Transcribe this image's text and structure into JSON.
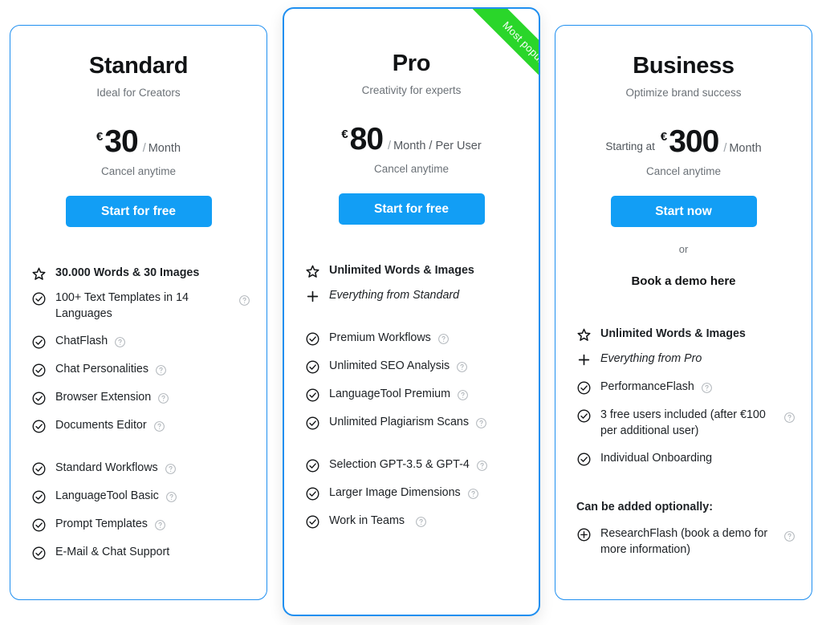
{
  "plans": [
    {
      "id": "standard",
      "name": "Standard",
      "tagline": "Ideal for Creators",
      "price": {
        "starting_at": "",
        "currency": "€",
        "amount": "30",
        "slash": "/",
        "period": "Month"
      },
      "cancel_note": "Cancel anytime",
      "cta_label": "Start for free",
      "or_label": "",
      "demo_link": "",
      "feature_groups": [
        {
          "items": [
            {
              "icon": "star-icon",
              "label": "30.000 Words & 30 Images",
              "style": "bold",
              "help": false,
              "wrap": false
            },
            {
              "icon": "check-circle-icon",
              "label": "100+ Text Templates in 14 Languages",
              "style": "normal",
              "help": true,
              "wrap": true
            },
            {
              "icon": "check-circle-icon",
              "label": "ChatFlash",
              "style": "normal",
              "help": true,
              "wrap": false
            },
            {
              "icon": "check-circle-icon",
              "label": "Chat Personalities",
              "style": "normal",
              "help": true,
              "wrap": false
            },
            {
              "icon": "check-circle-icon",
              "label": "Browser Extension",
              "style": "normal",
              "help": true,
              "wrap": false
            },
            {
              "icon": "check-circle-icon",
              "label": "Documents Editor",
              "style": "normal",
              "help": true,
              "wrap": false
            }
          ]
        },
        {
          "items": [
            {
              "icon": "check-circle-icon",
              "label": "Standard Workflows",
              "style": "normal",
              "help": true,
              "wrap": false
            },
            {
              "icon": "check-circle-icon",
              "label": "LanguageTool Basic",
              "style": "normal",
              "help": true,
              "wrap": false
            },
            {
              "icon": "check-circle-icon",
              "label": "Prompt Templates",
              "style": "normal",
              "help": true,
              "wrap": false
            },
            {
              "icon": "check-circle-icon",
              "label": "E-Mail & Chat Support",
              "style": "normal",
              "help": false,
              "wrap": false
            }
          ]
        }
      ]
    },
    {
      "id": "pro",
      "name": "Pro",
      "tagline": "Creativity for experts",
      "badge": "Most popular",
      "price": {
        "starting_at": "",
        "currency": "€",
        "amount": "80",
        "slash": "/",
        "period": "Month / Per User"
      },
      "cancel_note": "Cancel anytime",
      "cta_label": "Start for free",
      "or_label": "",
      "demo_link": "",
      "feature_groups": [
        {
          "items": [
            {
              "icon": "star-icon",
              "label": "Unlimited Words & Images",
              "style": "bold",
              "help": false,
              "wrap": false
            },
            {
              "icon": "plus-icon",
              "label": "Everything from Standard",
              "style": "italic",
              "help": false,
              "wrap": false
            }
          ]
        },
        {
          "items": [
            {
              "icon": "check-circle-icon",
              "label": "Premium Workflows",
              "style": "normal",
              "help": true,
              "wrap": false
            },
            {
              "icon": "check-circle-icon",
              "label": "Unlimited SEO Analysis",
              "style": "normal",
              "help": true,
              "wrap": false
            },
            {
              "icon": "check-circle-icon",
              "label": "LanguageTool Premium",
              "style": "normal",
              "help": true,
              "wrap": false
            },
            {
              "icon": "check-circle-icon",
              "label": "Unlimited Plagiarism Scans",
              "style": "normal",
              "help": true,
              "wrap": false
            }
          ]
        },
        {
          "items": [
            {
              "icon": "check-circle-icon",
              "label": "Selection GPT-3.5 & GPT-4",
              "style": "normal",
              "help": true,
              "wrap": false
            },
            {
              "icon": "check-circle-icon",
              "label": "Larger Image Dimensions",
              "style": "normal",
              "help": true,
              "wrap": false
            },
            {
              "icon": "check-circle-icon",
              "label": "Work in Teams",
              "style": "normal",
              "help": true,
              "wrap": false
            }
          ]
        }
      ]
    },
    {
      "id": "business",
      "name": "Business",
      "tagline": "Optimize brand success",
      "price": {
        "starting_at": "Starting at",
        "currency": "€",
        "amount": "300",
        "slash": "/",
        "period": "Month"
      },
      "cancel_note": "Cancel anytime",
      "cta_label": "Start now",
      "or_label": "or",
      "demo_link": "Book a demo here",
      "optional_title": "Can be added optionally:",
      "feature_groups": [
        {
          "items": [
            {
              "icon": "star-icon",
              "label": "Unlimited Words & Images",
              "style": "bold",
              "help": false,
              "wrap": false
            },
            {
              "icon": "plus-icon",
              "label": "Everything from Pro",
              "style": "italic",
              "help": false,
              "wrap": false
            },
            {
              "icon": "check-circle-icon",
              "label": "PerformanceFlash",
              "style": "normal",
              "help": true,
              "wrap": false
            },
            {
              "icon": "check-circle-icon",
              "label": "3 free users included (after €100 per additional user)",
              "style": "normal",
              "help": true,
              "wrap": true
            },
            {
              "icon": "check-circle-icon",
              "label": "Individual Onboarding",
              "style": "normal",
              "help": false,
              "wrap": false
            }
          ]
        },
        {
          "items": [
            {
              "icon": "plus-circle-icon",
              "label": "ResearchFlash (book a demo for more information)",
              "style": "normal",
              "help": true,
              "wrap": true
            }
          ]
        }
      ]
    }
  ],
  "colors": {
    "accent_blue": "#129ef5",
    "card_border": "#1f8ff0",
    "ribbon_green": "#2ad62a",
    "text_dark": "#1d2125",
    "text_muted": "#6b7177"
  }
}
